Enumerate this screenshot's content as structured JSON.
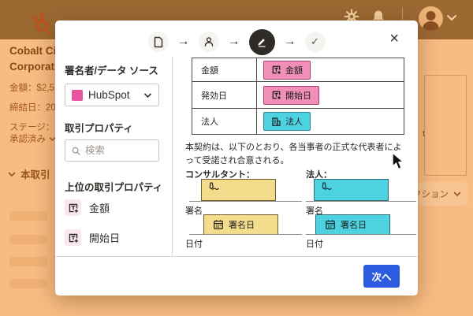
{
  "colors": {
    "header_bg": "#9b6832",
    "page_bg": "#f6bc82",
    "logo_orange": "#bc531f",
    "accent_pink": "#e8549e",
    "tag_pink_fill": "#f18fb9",
    "tag_pink_border": "#a93e6e",
    "tag_cyan_fill": "#4dd2e2",
    "tag_cyan_border": "#33808e",
    "sig_yellow_fill": "#f3dd8c",
    "sig_yellow_border": "#6e5c2e",
    "active_step_bg": "#2f2b26",
    "next_button_blue": "#2d5bdf"
  },
  "background": {
    "deal": {
      "company_line1": "Cobalt Ci",
      "company_line2": "Corporati",
      "amount_line": "金額：$2,5",
      "close_date_line": "締結日：20",
      "stage_label": "ステージ：",
      "stage_value": "承認済み",
      "section_title": "本取引"
    },
    "side_card_text": "t",
    "actions_label": "クション"
  },
  "modal": {
    "stepper": {
      "arrow": "→",
      "check": "✓",
      "steps": [
        {
          "name": "document",
          "state": "inactive"
        },
        {
          "name": "recipients",
          "state": "inactive"
        },
        {
          "name": "fields",
          "state": "active"
        },
        {
          "name": "review",
          "state": "inactive"
        }
      ]
    },
    "close_label": "×",
    "sidebar": {
      "signer_heading": "署名者/データ ソース",
      "source_value": "HubSpot",
      "properties_heading": "取引プロパティ",
      "search_placeholder": "検索",
      "top_properties_heading": "上位の取引プロパティ",
      "properties": [
        {
          "label": "金額"
        },
        {
          "label": "開始日"
        }
      ]
    },
    "document": {
      "rows": [
        {
          "label": "金額",
          "tag": "金額"
        },
        {
          "label": "発効日",
          "tag": "開始日"
        },
        {
          "label": "法人",
          "tag": "法人"
        }
      ],
      "agreement_text": "本契約は、以下のとおり、各当事者の正式な代表者によって受諾され合意される。",
      "signatures": [
        {
          "title": "コンサルタント：",
          "sign_label": "署名",
          "date_tag": "署名日",
          "date_label": "日付"
        },
        {
          "title": "法人：",
          "sign_label": "署名",
          "date_tag": "署名日",
          "date_label": "日付"
        }
      ]
    },
    "footer": {
      "next_label": "次へ"
    }
  }
}
